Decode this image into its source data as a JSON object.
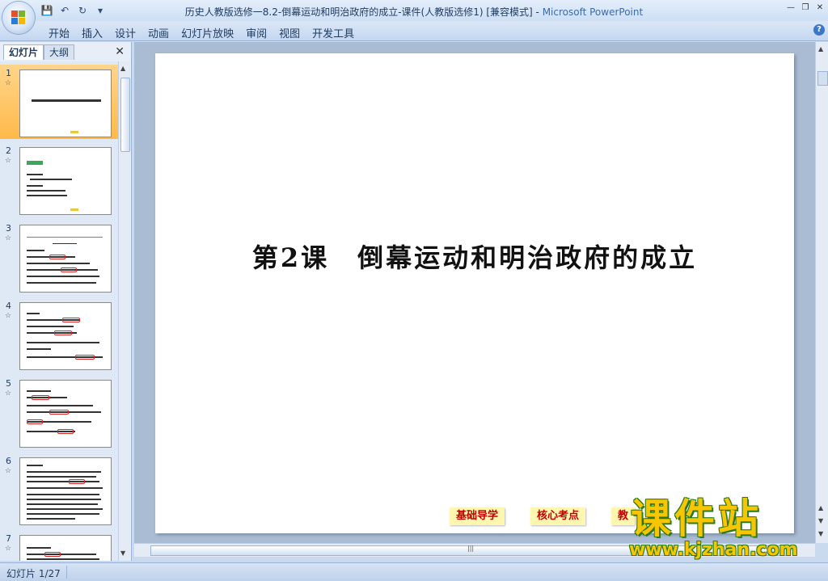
{
  "window": {
    "title": "历史人教版选修一8.2-倒幕运动和明治政府的成立-课件(人教版选修1) [兼容模式] - ",
    "app_name": "Microsoft PowerPoint"
  },
  "ribbon": {
    "tabs": [
      "开始",
      "插入",
      "设计",
      "动画",
      "幻灯片放映",
      "审阅",
      "视图",
      "开发工具"
    ],
    "help": "?"
  },
  "pane": {
    "tab_slides": "幻灯片",
    "tab_outline": "大纲",
    "close": "✕"
  },
  "thumbnails": [
    {
      "num": "1"
    },
    {
      "num": "2"
    },
    {
      "num": "3"
    },
    {
      "num": "4"
    },
    {
      "num": "5"
    },
    {
      "num": "6"
    },
    {
      "num": "7"
    }
  ],
  "slide": {
    "title": "第2课　倒幕运动和明治政府的成立",
    "nav_buttons": [
      "基础导学",
      "核心考点",
      "教"
    ]
  },
  "watermark": {
    "text": "课件站",
    "url": "www.kjzhan.com"
  },
  "status": {
    "slide_counter": "幻灯片 1/27"
  },
  "colors": {
    "accent": "#ffb94a",
    "nav_button_bg": "#fff7b0",
    "nav_button_text": "#c40000",
    "watermark": "#f7c600"
  }
}
